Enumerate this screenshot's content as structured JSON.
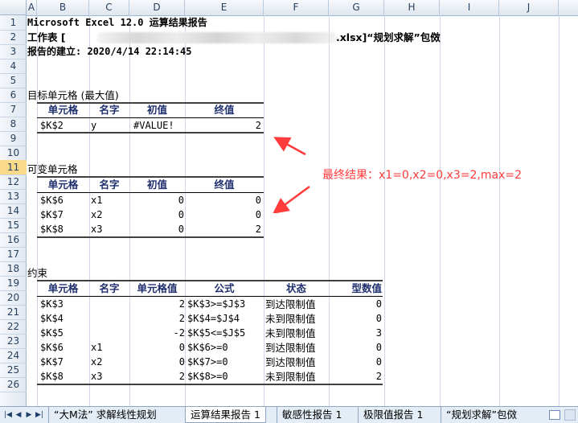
{
  "columns": [
    "A",
    "B",
    "C",
    "D",
    "E",
    "F",
    "G",
    "H",
    "I",
    "J"
  ],
  "rows": [
    "1",
    "2",
    "3",
    "4",
    "5",
    "6",
    "7",
    "8",
    "9",
    "10",
    "11",
    "12",
    "13",
    "14",
    "15",
    "16",
    "17",
    "18",
    "19",
    "20",
    "21",
    "22",
    "23",
    "24",
    "25",
    "26"
  ],
  "report": {
    "title": "Microsoft Excel 12.0 运算结果报告",
    "worksheet_prefix": "工作表 [",
    "worksheet_suffix": ".xlsx]“规划求解”包傚",
    "created": "报告的建立: 2020/4/14 22:14:45"
  },
  "objective": {
    "section_title": "目标单元格 (最大值)",
    "headers": [
      "单元格",
      "名字",
      "初值",
      "终值"
    ],
    "rows": [
      [
        "$K$2",
        "y",
        "#VALUE!",
        "2"
      ]
    ]
  },
  "variables": {
    "section_title": "可变单元格",
    "headers": [
      "单元格",
      "名字",
      "初值",
      "终值"
    ],
    "rows": [
      [
        "$K$6",
        "x1",
        "0",
        "0"
      ],
      [
        "$K$7",
        "x2",
        "0",
        "0"
      ],
      [
        "$K$8",
        "x3",
        "0",
        "2"
      ]
    ]
  },
  "constraints": {
    "section_title": "约束",
    "headers": [
      "单元格",
      "名字",
      "单元格值",
      "公式",
      "状态",
      "型数值"
    ],
    "rows": [
      [
        "$K$3",
        "",
        "2",
        "$K$3>=$J$3",
        "到达限制值",
        "0"
      ],
      [
        "$K$4",
        "",
        "2",
        "$K$4=$J$4",
        "未到限制值",
        "0"
      ],
      [
        "$K$5",
        "",
        "-2",
        "$K$5<=$J$5",
        "未到限制值",
        "3"
      ],
      [
        "$K$6",
        "x1",
        "0",
        "$K$6>=0",
        "到达限制值",
        "0"
      ],
      [
        "$K$7",
        "x2",
        "0",
        "$K$7>=0",
        "到达限制值",
        "0"
      ],
      [
        "$K$8",
        "x3",
        "2",
        "$K$8>=0",
        "未到限制值",
        "2"
      ]
    ]
  },
  "annotation": "最终结果：x1=0,x2=0,x3=2,max=2",
  "sheet_tabs": [
    "“大M法” 求解线性规划",
    "运算结果报告 1",
    "敏感性报告 1",
    "极限值报告 1",
    "“规划求解”包傚"
  ],
  "active_tab": "运算结果报告 1",
  "active_row": "11",
  "colors": {
    "arrow": "#ff3b3b",
    "header_text": "#1f2f6e",
    "selected_row": "#f9d98a"
  }
}
